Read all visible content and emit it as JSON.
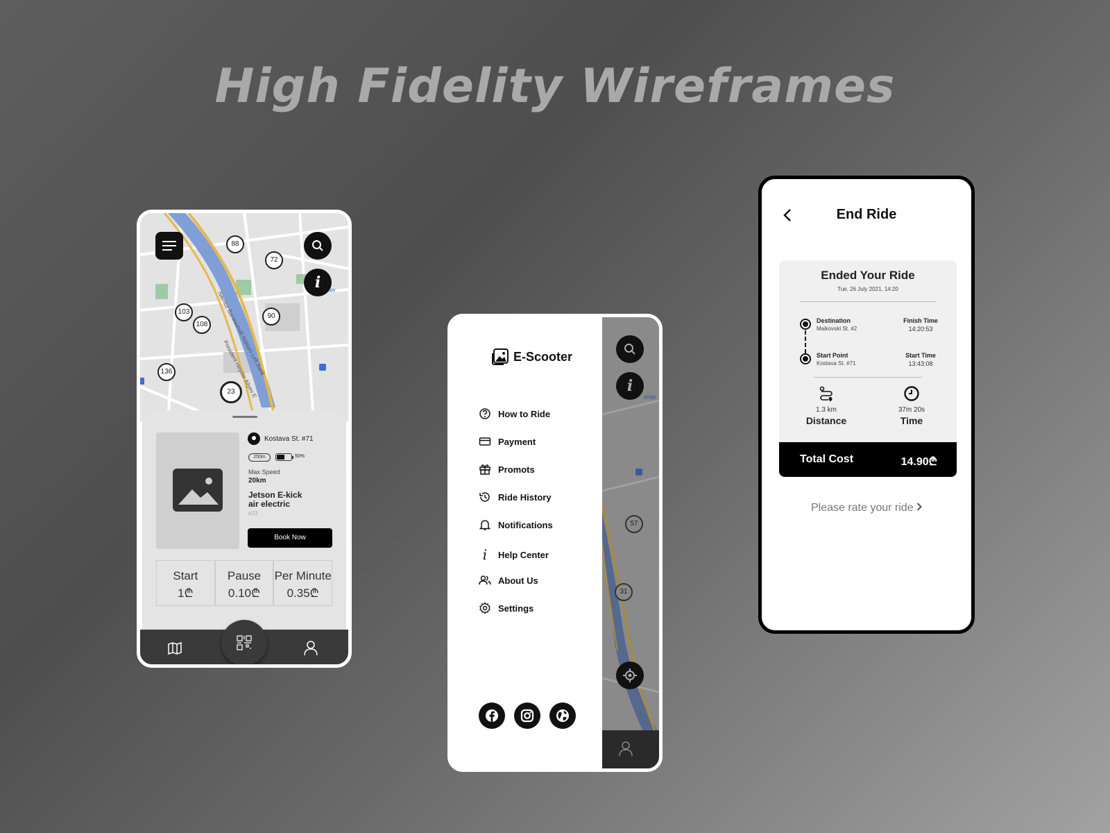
{
  "headline": "High Fidelity Wireframes",
  "phone1": {
    "map_badges": [
      "88",
      "72",
      "103",
      "108",
      "90",
      "136",
      "23"
    ],
    "location": "Kostava St. #71",
    "range_pill": "250m",
    "battery_percent_label": "50%",
    "battery_level": 0.5,
    "max_speed_label": "Max Speed",
    "max_speed_value": "20km",
    "scooter_name_line1": "Jetson E-kick",
    "scooter_name_line2": "air electric",
    "scooter_id": "#23",
    "book_button": "Book Now",
    "prices": [
      {
        "label": "Start",
        "value": "1₾"
      },
      {
        "label": "Pause",
        "value": "0.10₾"
      },
      {
        "label": "Per Minute",
        "value": "0.35₾"
      }
    ],
    "icons": [
      "menu-icon",
      "search-icon",
      "info-icon",
      "map-icon",
      "qr-code-icon",
      "profile-icon"
    ]
  },
  "phone2": {
    "brand": "E-Scooter",
    "menu": [
      {
        "label": "How to Ride",
        "icon": "question-icon"
      },
      {
        "label": "Payment",
        "icon": "card-icon"
      },
      {
        "label": "Promots",
        "icon": "gift-icon"
      },
      {
        "label": "Ride History",
        "icon": "history-icon"
      },
      {
        "label": "Notifications",
        "icon": "bell-icon"
      },
      {
        "label": "Help Center",
        "icon": "info-icon"
      },
      {
        "label": "About Us",
        "icon": "users-icon"
      },
      {
        "label": "Settings",
        "icon": "gear-icon"
      }
    ],
    "map_badges": [
      "57",
      "31"
    ],
    "social": [
      "facebook-icon",
      "instagram-icon",
      "globe-icon"
    ]
  },
  "phone3": {
    "title": "End Ride",
    "card_title": "Ended Your Ride",
    "card_date": "Tue, 26 July 2021, 14:20",
    "destination_label": "Destination",
    "destination_value": "Maikovski St. #2",
    "finish_label": "Finish Time",
    "finish_value": "14:20:53",
    "start_label": "Start Point",
    "start_value": "Kostava St. #71",
    "start_time_label": "Start Time",
    "start_time_value": "13:43:08",
    "distance_value": "1.3 km",
    "distance_label": "Distance",
    "time_value": "37m 20s",
    "time_label": "Time",
    "total_label": "Total Cost",
    "total_value": "14.90₾",
    "rate_link": "Please rate your ride"
  }
}
